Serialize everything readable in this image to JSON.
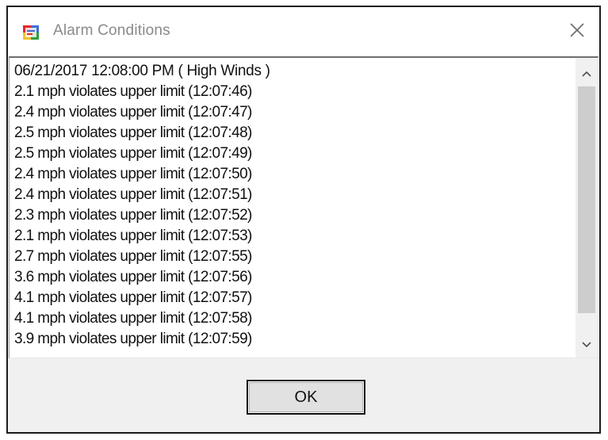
{
  "window": {
    "title": "Alarm Conditions",
    "icon": "application-forms-icon",
    "close_icon": "close-icon"
  },
  "alarm_list": {
    "items": [
      "06/21/2017 12:08:00 PM ( High Winds )",
      "2.1 mph violates upper limit (12:07:46)",
      "2.4 mph violates upper limit (12:07:47)",
      "2.5 mph violates upper limit (12:07:48)",
      "2.5 mph violates upper limit (12:07:49)",
      "2.4 mph violates upper limit (12:07:50)",
      "2.4 mph violates upper limit (12:07:51)",
      "2.3 mph violates upper limit (12:07:52)",
      "2.1 mph violates upper limit (12:07:53)",
      "2.7 mph violates upper limit (12:07:55)",
      "3.6 mph violates upper limit (12:07:56)",
      "4.1 mph violates upper limit (12:07:57)",
      "4.1 mph violates upper limit (12:07:58)",
      "3.9 mph violates upper limit (12:07:59)"
    ]
  },
  "buttons": {
    "ok_label": "OK"
  },
  "colors": {
    "dialog_background": "#f0f0f0",
    "title_text": "#8a8a8a",
    "list_background": "#ffffff",
    "scroll_thumb": "#cdcdcd",
    "button_face": "#e1e1e1"
  }
}
